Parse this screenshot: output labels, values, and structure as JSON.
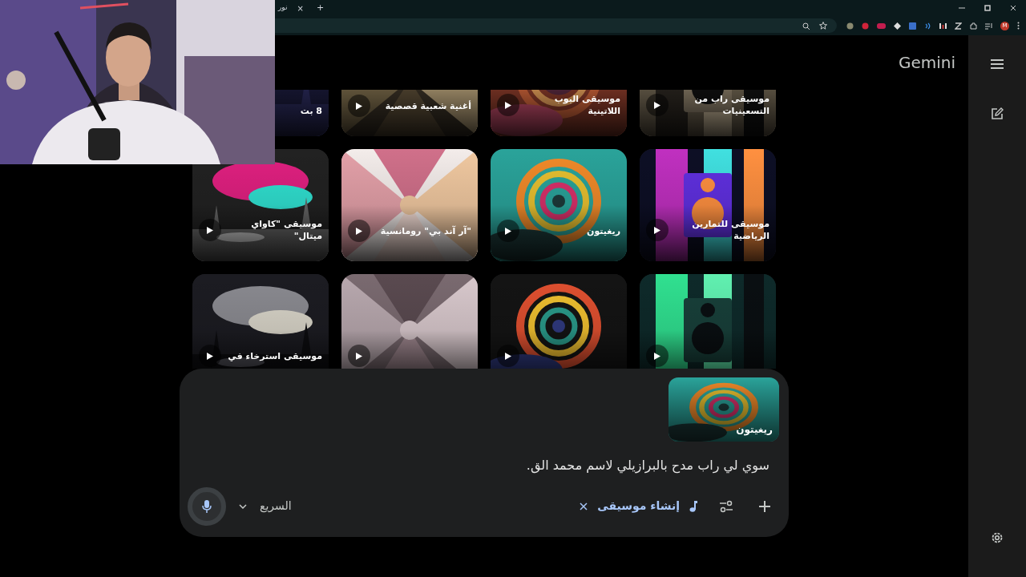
{
  "browser": {
    "tab_title": "نور",
    "new_tab": "+",
    "tab_close": "×",
    "profile_initial": "M"
  },
  "app": {
    "title": "Gemini"
  },
  "cards": [
    {
      "title": "موسيقى راب من التسعينيات",
      "kind": "picture",
      "play_button": true
    },
    {
      "title": "موسيقى البوب اللاتينية",
      "kind": "picture",
      "play_button": true
    },
    {
      "title": "أغنية شعبية قصصية",
      "kind": "picture",
      "play_button": true
    },
    {
      "title": "8 بت",
      "kind": "picture",
      "play_button": false
    },
    {
      "title": "موسيقى للتمارين الرياضية",
      "kind": "picture",
      "play_button": true
    },
    {
      "title": "ريغيتون",
      "kind": "picture",
      "play_button": true
    },
    {
      "title": "\"آر آند بي\" رومانسية",
      "kind": "picture",
      "play_button": true
    },
    {
      "title": "موسيقى \"كاواي ميتال\"",
      "kind": "picture",
      "play_button": true
    },
    {
      "kind": "picture",
      "play_button": true
    },
    {
      "kind": "picture",
      "play_button": true
    },
    {
      "kind": "picture",
      "play_button": true
    },
    {
      "title": "موسيقى استرخاء في",
      "kind": "picture",
      "play_button": true
    }
  ],
  "prompt": {
    "attachment": {
      "title": "ريغيتون"
    },
    "value": "سوي لي راب مدح بالبرازيلي لاسم محمد الق.",
    "tool_chip": "إنشاء موسيقى",
    "mode": "السريع"
  }
}
